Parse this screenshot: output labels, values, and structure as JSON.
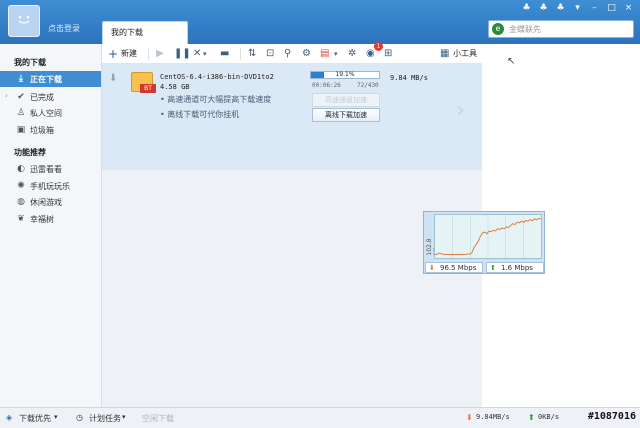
{
  "header": {
    "login_text": "点击登录",
    "active_tab": "我的下载",
    "search_placeholder": "金蝶联先",
    "window_controls": [
      "skin-icon",
      "chat-icon",
      "app-icon",
      "menu-icon",
      "minimize-icon",
      "maximize-icon",
      "close-icon"
    ]
  },
  "sidebar": {
    "section_downloads": "我的下载",
    "items": [
      {
        "label": "正在下载",
        "icon": "download-icon",
        "active": true
      },
      {
        "label": "已完成",
        "icon": "check-icon",
        "active": false
      },
      {
        "label": "私人空间",
        "icon": "lock-icon",
        "active": false
      },
      {
        "label": "垃圾箱",
        "icon": "trash-icon",
        "active": false
      }
    ],
    "section_features": "功能推荐",
    "features": [
      {
        "label": "迅雷看看",
        "icon": "play-icon"
      },
      {
        "label": "手机玩玩乐",
        "icon": "phone-icon"
      },
      {
        "label": "休闲游戏",
        "icon": "gamepad-icon"
      },
      {
        "label": "幸福树",
        "icon": "leaf-icon"
      }
    ]
  },
  "toolbar": {
    "new_label": "新建",
    "tools_label": "小工具",
    "badge_count": "1"
  },
  "task": {
    "filename": "CentOS-6.4-i386-bin-DVD1to2",
    "size": "4.58 GB",
    "progress_text": "19.1%",
    "progress": 0.191,
    "elapsed": "00:06:26",
    "pieces": "72/430",
    "speed": "9.84  MB/s",
    "hint_1": "高速通道可大幅提高下载速度",
    "hint_2": "离线下载可代你挂机",
    "btn_highspeed": "高速通道加速",
    "btn_offline": "离线下载加速"
  },
  "speed_widget": {
    "y_label": "102.8 Mbps",
    "download": "96.5 Mbps",
    "upload": "1.6 Mbps"
  },
  "chart_data": {
    "type": "line",
    "title": "",
    "ylabel": "102.8 Mbps",
    "series": [
      {
        "values": [
          8,
          9,
          12,
          10,
          9,
          8,
          9,
          8,
          9,
          8,
          8,
          9,
          8,
          9,
          8,
          10,
          9,
          12,
          25,
          32,
          40,
          52,
          60,
          62,
          58,
          64,
          63,
          66,
          65,
          70,
          68,
          72,
          70,
          74,
          73,
          78,
          82,
          80,
          86,
          84,
          88,
          85,
          90,
          88,
          92,
          89,
          94,
          91,
          95,
          93
        ]
      }
    ],
    "ylim": [
      0,
      102.8
    ],
    "grid": true
  },
  "statusbar": {
    "priority": "下载优先",
    "schedule": "计划任务",
    "idle": "空闲下载",
    "down_speed": "9.84MB/s",
    "up_speed": "0KB/s",
    "watermark": "#1087016"
  },
  "colors": {
    "accent": "#3f8ed3",
    "task_bg": "#dbe8f5",
    "progress": "#2f7fd0",
    "graph_line": "#e07a3a"
  }
}
